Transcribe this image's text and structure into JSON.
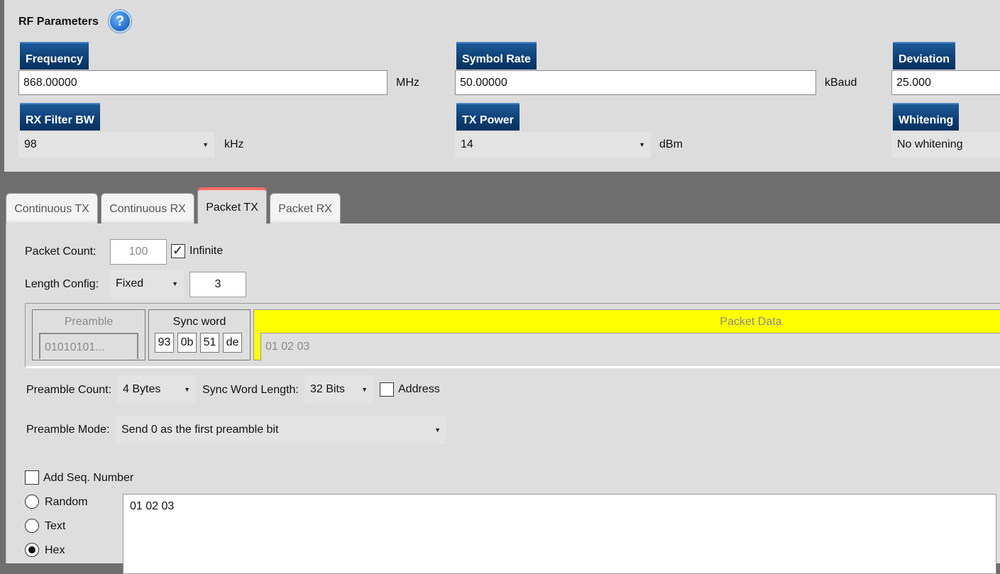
{
  "rf": {
    "title": "RF Parameters",
    "help_glyph": "?",
    "frequency": {
      "label": "Frequency",
      "value": "868.00000",
      "unit": "MHz"
    },
    "symbol_rate": {
      "label": "Symbol Rate",
      "value": "50.00000",
      "unit": "kBaud"
    },
    "deviation": {
      "label": "Deviation",
      "value": "25.000"
    },
    "rx_filter_bw": {
      "label": "RX Filter BW",
      "value": "98",
      "unit": "kHz"
    },
    "tx_power": {
      "label": "TX Power",
      "value": "14",
      "unit": "dBm"
    },
    "whitening": {
      "label": "Whitening",
      "value": "No whitening"
    }
  },
  "tabs": [
    {
      "label": "Continuous TX",
      "active": false
    },
    {
      "label": "Continuous RX",
      "active": false
    },
    {
      "label": "Packet TX",
      "active": true
    },
    {
      "label": "Packet RX",
      "active": false
    }
  ],
  "packet_tx": {
    "packet_count_label": "Packet Count:",
    "packet_count_value": "100",
    "infinite_label": "Infinite",
    "infinite_checked": true,
    "length_config_label": "Length Config:",
    "length_config_value": "Fixed",
    "length_value": "3",
    "frame": {
      "preamble_label": "Preamble",
      "preamble_value": "01010101...",
      "sync_label": "Sync word",
      "sync_bytes": [
        "93",
        "0b",
        "51",
        "de"
      ],
      "packet_data_label": "Packet Data",
      "packet_data_value": "01 02 03"
    },
    "preamble_count_label": "Preamble Count:",
    "preamble_count_value": "4 Bytes",
    "sync_word_length_label": "Sync Word Length:",
    "sync_word_length_value": "32 Bits",
    "address_label": "Address",
    "address_checked": false,
    "preamble_mode_label": "Preamble Mode:",
    "preamble_mode_value": "Send 0 as the first preamble bit",
    "add_seq_label": "Add Seq. Number",
    "add_seq_checked": false,
    "data_modes": [
      {
        "label": "Random",
        "selected": false
      },
      {
        "label": "Text",
        "selected": false
      },
      {
        "label": "Hex",
        "selected": true
      }
    ],
    "payload": "01 02 03"
  },
  "colors": {
    "header_blue": "#0c3e73",
    "packet_data_highlight": "#ffff00",
    "active_tab_accent": "#ff6a6a"
  }
}
